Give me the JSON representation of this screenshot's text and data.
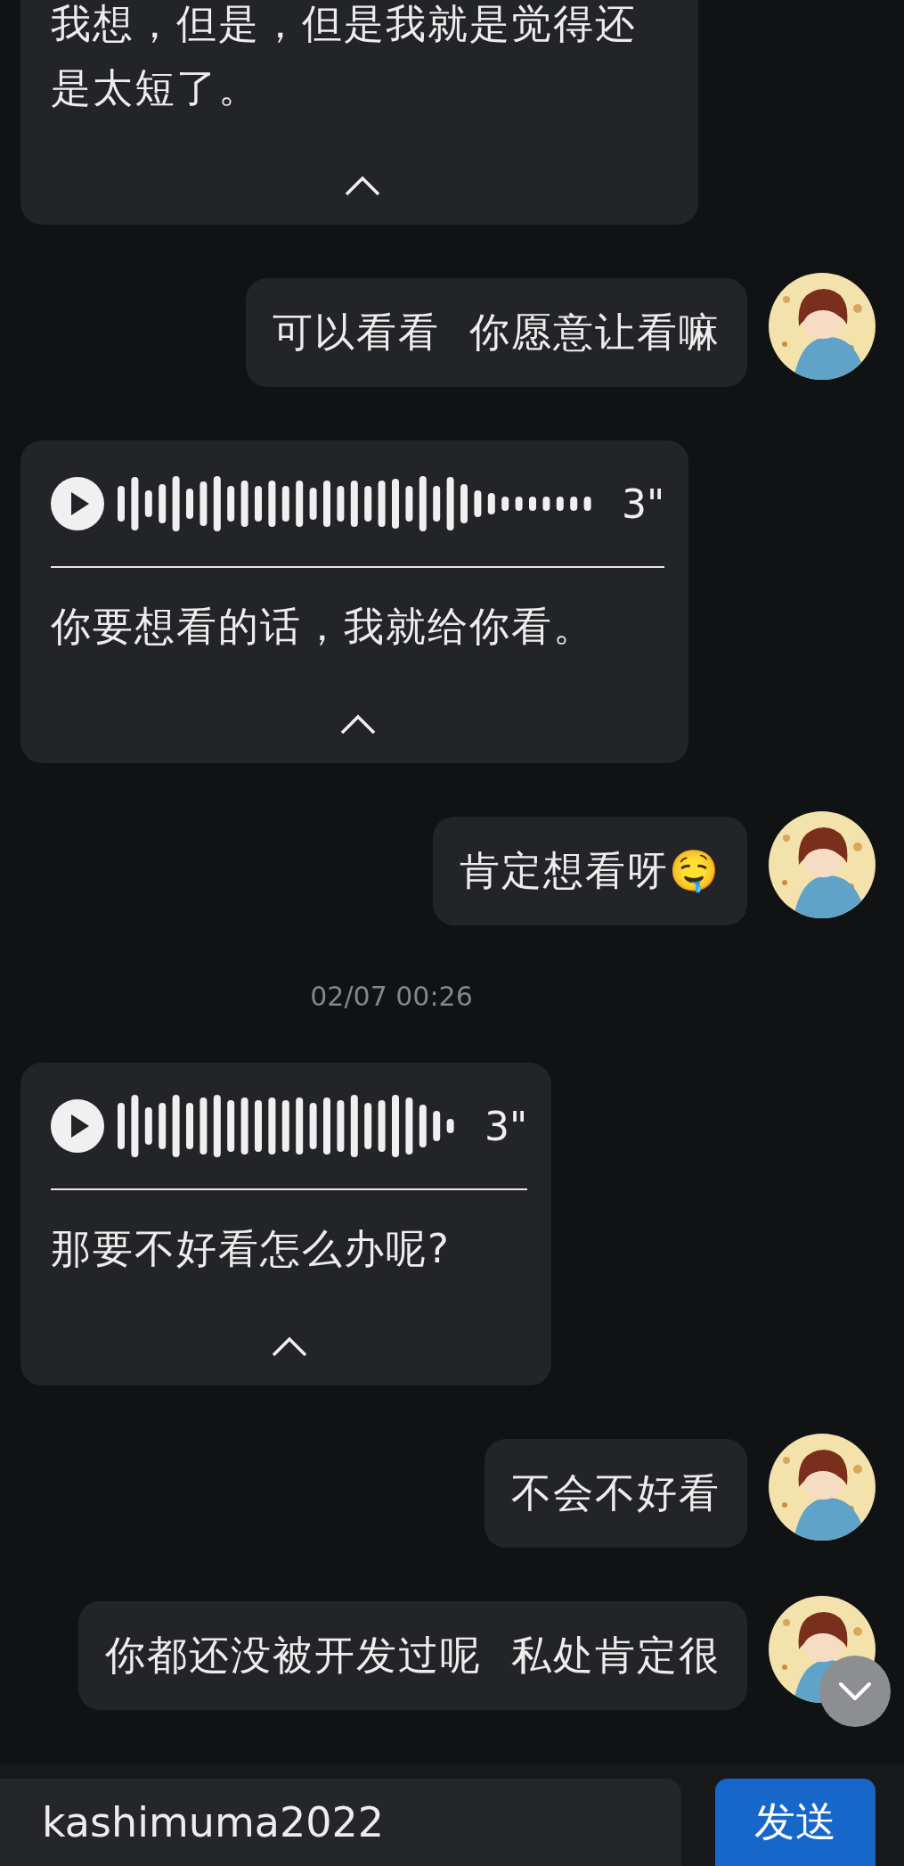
{
  "messages": [
    {
      "kind": "voice",
      "outgoing": false,
      "transcript": "我想，但是，但是我就是觉得还是太短了。",
      "expanded": true
    },
    {
      "kind": "text",
      "outgoing": true,
      "text": "可以看看  你愿意让看嘛"
    },
    {
      "kind": "voice",
      "outgoing": false,
      "duration": "3\"",
      "transcript": "你要想看的话，我就给你看。",
      "expanded": true
    },
    {
      "kind": "text",
      "outgoing": true,
      "text": "肯定想看呀🤤"
    },
    {
      "kind": "time",
      "text": "02/07 00:26"
    },
    {
      "kind": "voice",
      "outgoing": false,
      "duration": "3\"",
      "transcript": "那要不好看怎么办呢?",
      "expanded": true
    },
    {
      "kind": "text",
      "outgoing": true,
      "text": "不会不好看"
    },
    {
      "kind": "text",
      "outgoing": true,
      "text": "你都还没被开发过呢  私处肯定很"
    }
  ],
  "input": {
    "value": "kashimuma2022"
  },
  "send_button": "发送"
}
